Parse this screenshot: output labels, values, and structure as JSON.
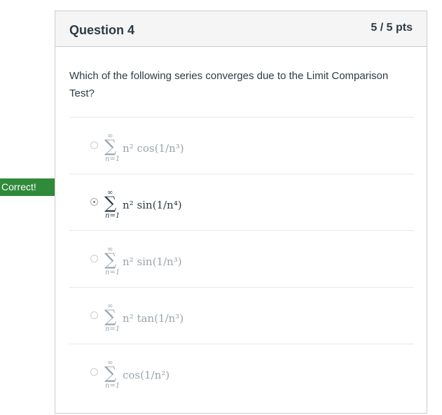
{
  "question": {
    "title": "Question 4",
    "points": "5 / 5 pts",
    "text": "Which of the following series converges due to the Limit Comparison Test?"
  },
  "answers": [
    {
      "sum_upper": "∞",
      "sum_lower": "n=1",
      "term": "n² cos(1/n³)",
      "selected": false
    },
    {
      "sum_upper": "∞",
      "sum_lower": "n=1",
      "term": "n² sin(1/n⁴)",
      "selected": true
    },
    {
      "sum_upper": "∞",
      "sum_lower": "n=1",
      "term": "n² sin(1/n³)",
      "selected": false
    },
    {
      "sum_upper": "∞",
      "sum_lower": "n=1",
      "term": "n² tan(1/n³)",
      "selected": false
    },
    {
      "sum_upper": "∞",
      "sum_lower": "n=1",
      "term": "cos(1/n²)",
      "selected": false
    }
  ],
  "feedback": {
    "correct_label": "Correct!"
  },
  "colors": {
    "correct": "#2f8a3a",
    "border": "#c7cdd1",
    "header_bg": "#f5f5f5",
    "muted_text": "#9aa4ab"
  }
}
